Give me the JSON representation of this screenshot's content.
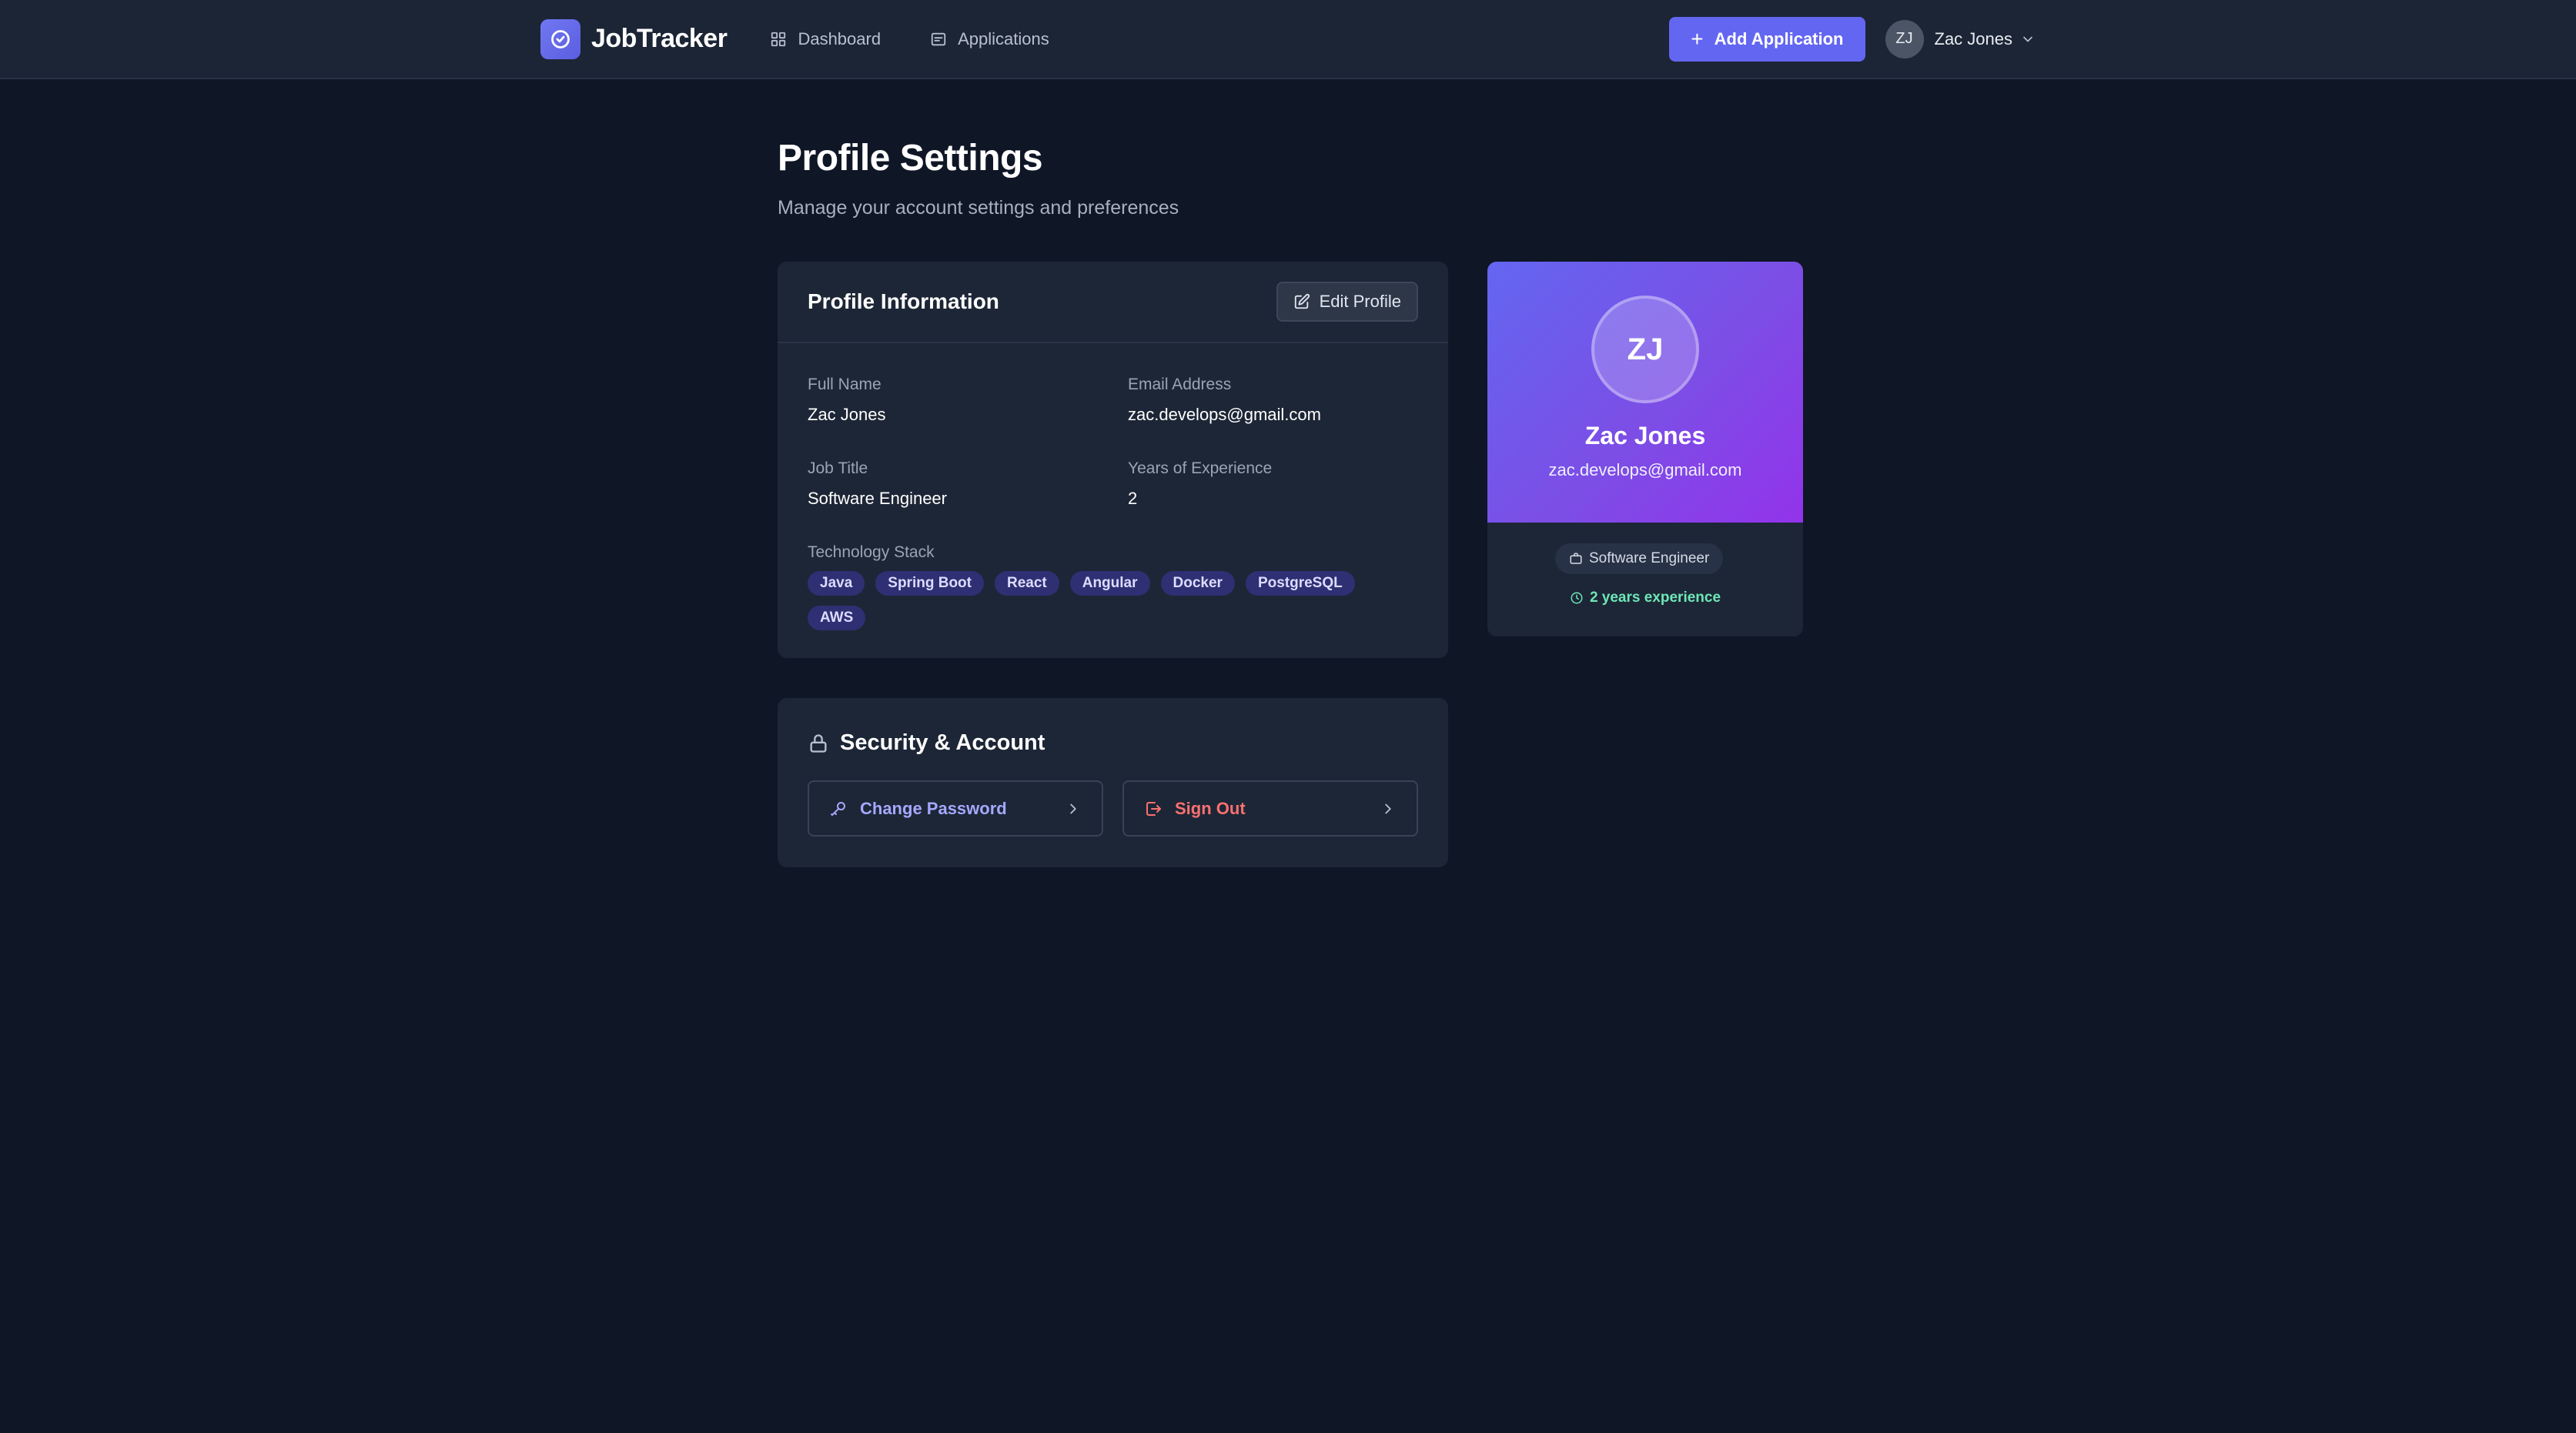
{
  "app": {
    "name": "JobTracker"
  },
  "nav": {
    "links": [
      {
        "label": "Dashboard",
        "icon": "grid-icon"
      },
      {
        "label": "Applications",
        "icon": "list-icon"
      }
    ],
    "add_button": "Add Application",
    "user": {
      "initials": "ZJ",
      "name": "Zac Jones"
    }
  },
  "page": {
    "title": "Profile Settings",
    "subtitle": "Manage your account settings and preferences"
  },
  "profile": {
    "card_title": "Profile Information",
    "edit_label": "Edit Profile",
    "fields": {
      "full_name": {
        "label": "Full Name",
        "value": "Zac Jones"
      },
      "email": {
        "label": "Email Address",
        "value": "zac.develops@gmail.com"
      },
      "job_title": {
        "label": "Job Title",
        "value": "Software Engineer"
      },
      "experience": {
        "label": "Years of Experience",
        "value": "2"
      }
    },
    "tech_label": "Technology Stack",
    "tech_stack": [
      "Java",
      "Spring Boot",
      "React",
      "Angular",
      "Docker",
      "PostgreSQL",
      "AWS"
    ]
  },
  "security": {
    "title": "Security & Account",
    "change_password": "Change Password",
    "sign_out": "Sign Out"
  },
  "side_card": {
    "initials": "ZJ",
    "name": "Zac Jones",
    "email": "zac.develops@gmail.com",
    "job_badge": "Software Engineer",
    "experience_text": "2 years experience"
  },
  "colors": {
    "accent": "#6366f1",
    "gradient_end": "#9333ea",
    "danger": "#f87171",
    "success": "#6ee7b7"
  }
}
